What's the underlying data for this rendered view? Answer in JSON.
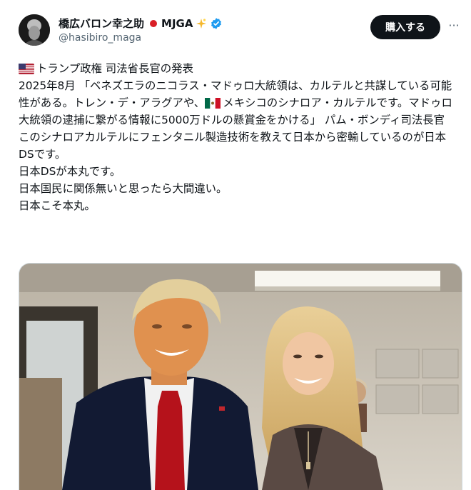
{
  "author": {
    "display_name": "橋広バロン幸之助",
    "badge_text": "MJGA",
    "sparkle_icon": "sparkle-icon",
    "handle": "@hasibiro_maga",
    "verified_color": "#1d9bf0"
  },
  "actions": {
    "buy_label": "購入する",
    "more_label": "···"
  },
  "tweet": {
    "line1_text": "トランプ政権 司法省長官の発表",
    "para1_a": "2025年8月 「ベネズエラのニコラス・マドゥロ大統領は、カルテルと共謀している可能性がある。トレン・デ・アラグアや、",
    "para1_b": "メキシコのシナロア・カルテルです。マドゥロ大統領の逮捕に繋がる情報に5000万ドルの懸賞金をかける」 パム・ボンディ司法長官",
    "para2": "このシナロアカルテルにフェンタニル製造技術を教えて日本から密輸しているのが日本DSです。",
    "para3": "日本DSが本丸です。",
    "para4": "日本国民に関係無いと思ったら大間違い。",
    "para5": "日本こそ本丸。"
  },
  "colors": {
    "brand_dark": "#0f1419",
    "secondary": "#536471"
  }
}
